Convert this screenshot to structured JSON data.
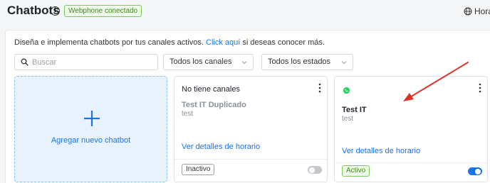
{
  "header": {
    "title": "Chatbots",
    "info_icon": "info-icon",
    "connection_status": "Webphone conectado",
    "timezone_label": "Hora",
    "timezone_icon": "globe-icon"
  },
  "panel": {
    "intro_text": "Diseña e implementa chatbots por tus canales activos.",
    "intro_link": "Click aquí",
    "intro_suffix": "si deseas conocer más."
  },
  "filters": {
    "search_placeholder": "Buscar",
    "search_value": "",
    "channels_selected": "Todos los canales",
    "states_selected": "Todos los estados"
  },
  "add_card": {
    "label": "Agregar nuevo chatbot",
    "icon": "plus-icon"
  },
  "chatbots": [
    {
      "channel_label": "No tiene canales",
      "name": "Test IT Duplicado",
      "description": "test",
      "schedule_link": "Ver detalles de horario",
      "status": "Inactivo",
      "enabled": false
    },
    {
      "channel_icon": "whatsapp-icon",
      "name": "Test IT",
      "description": "test",
      "schedule_link": "Ver detalles de horario",
      "status": "Activo",
      "enabled": true
    }
  ],
  "colors": {
    "accent": "#1a73e8",
    "success": "#3a8a17",
    "annotation_arrow": "#e0302a",
    "whatsapp": "#25d366"
  }
}
